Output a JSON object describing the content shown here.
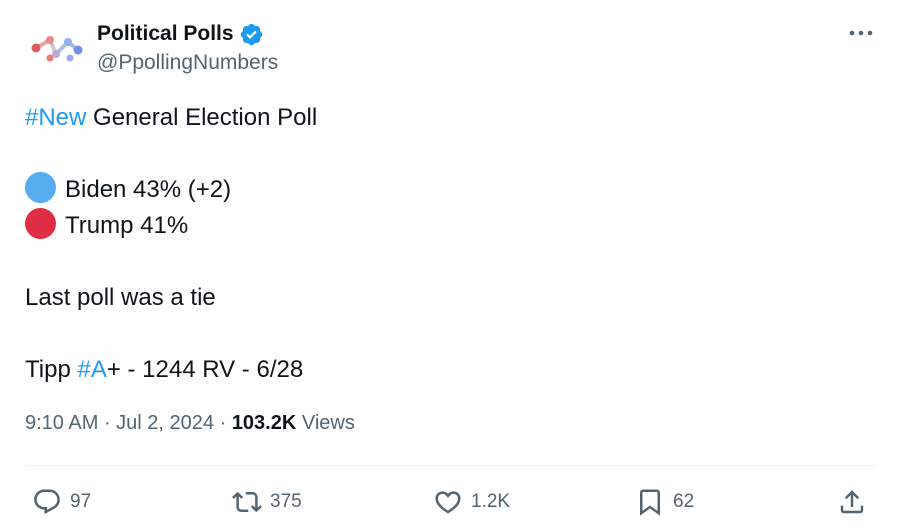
{
  "author": {
    "display_name": "Political Polls",
    "handle": "@PpollingNumbers",
    "verified": true
  },
  "body": {
    "line1": {
      "hashtag": "#New",
      "rest": " General Election Poll"
    },
    "candidates": [
      {
        "label": "Biden 43% (+2)",
        "color": "#55acee"
      },
      {
        "label": "Trump 41%",
        "color": "#dd2e44"
      }
    ],
    "note": "Last poll was a tie",
    "source": {
      "prefix": "Tipp ",
      "hashtag": "#A",
      "rest": "+ - 1244 RV - 6/28"
    }
  },
  "meta": {
    "time": "9:10 AM",
    "sep1": " · ",
    "date": "Jul 2, 2024",
    "sep2": " · ",
    "views_count": "103.2K",
    "views_label": " Views"
  },
  "actions": {
    "replies": "97",
    "reposts": "375",
    "likes": "1.2K",
    "bookmarks": "62"
  },
  "colors": {
    "accent": "#1d9bf0",
    "secondary_text": "#536471",
    "primary_text": "#0f1419"
  }
}
